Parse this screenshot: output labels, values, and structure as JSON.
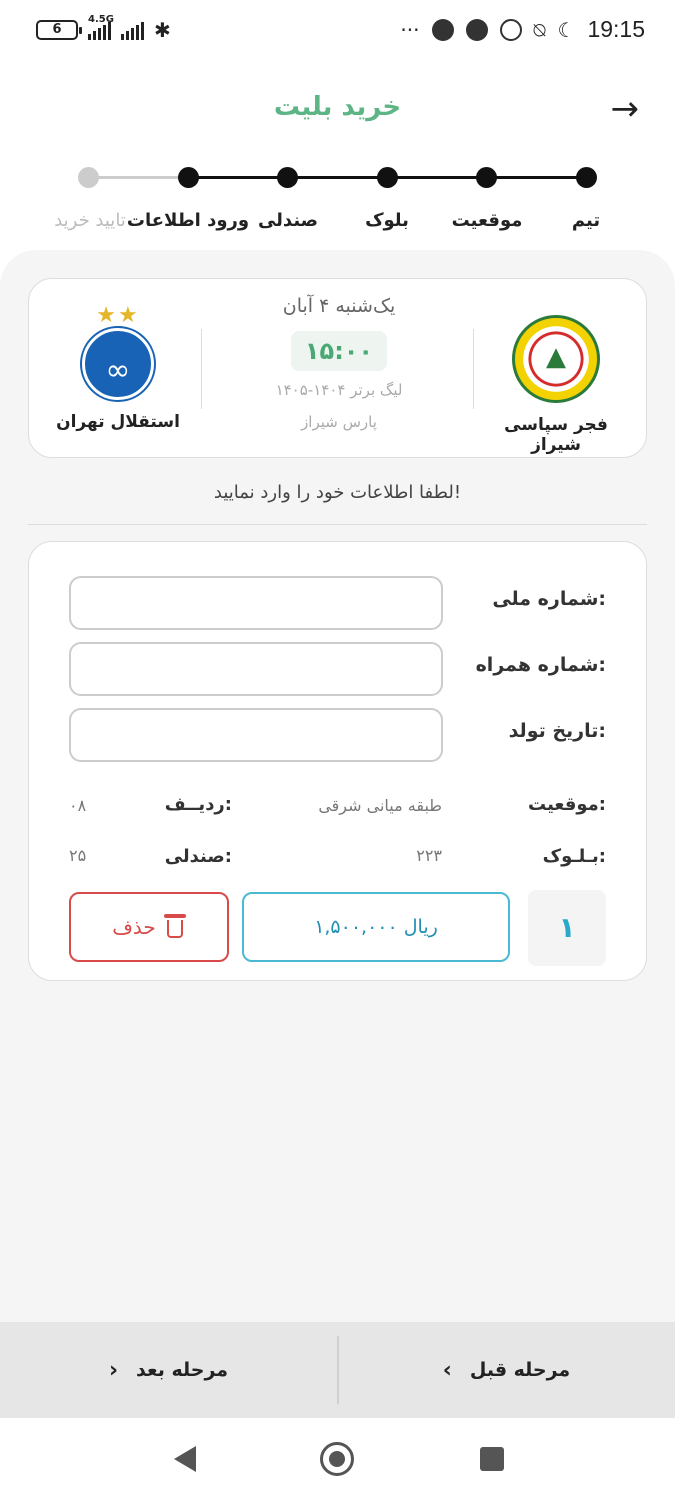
{
  "status_bar": {
    "battery": "6",
    "network": "4.5G",
    "time": "19:15",
    "dots": "···"
  },
  "header": {
    "title": "خرید بلیت",
    "back_icon": "arrow-right-icon"
  },
  "stepper": {
    "steps": [
      {
        "label": "تیم",
        "done": true
      },
      {
        "label": "موقعیت",
        "done": true
      },
      {
        "label": "بلوک",
        "done": true
      },
      {
        "label": "صندلی",
        "done": true
      },
      {
        "label": "ورود اطلاعات",
        "done": true
      },
      {
        "label": "تایید خرید",
        "done": false
      }
    ]
  },
  "match": {
    "home_team": "فجر سپاسی شیراز",
    "away_team": "استقلال تهران",
    "away_stars": "★★",
    "date": "یک‌شنبه ۴ آبان",
    "time": "۱۵:۰۰",
    "league": "لیگ برتر ۱۴۰۴-۱۴۰۵",
    "venue": "پارس شیراز"
  },
  "hint": "لطفا اطلاعات خود را وارد نمایید!",
  "form": {
    "national_id_label": "شماره ملی:",
    "mobile_label": "شماره همراه:",
    "birthdate_label": "تاریخ تولد:",
    "position_label": "موقعیت:",
    "position_value": "طبقه میانی شرقی",
    "row_label": "ردیــف:",
    "row_value": "۰۸",
    "block_label": "بـلـوک:",
    "block_value": "۲۲۳",
    "seat_label": "صندلی:",
    "seat_value": "۲۵",
    "quantity": "۱",
    "price": "۱,۵۰۰,۰۰۰ ریال",
    "delete_label": "حذف"
  },
  "bottom_nav": {
    "prev_label": "مرحله قبل",
    "next_label": "مرحله بعد"
  },
  "colors": {
    "accent_green": "#5db585",
    "price_blue": "#4bb8d4",
    "delete_red": "#d94a4a"
  }
}
